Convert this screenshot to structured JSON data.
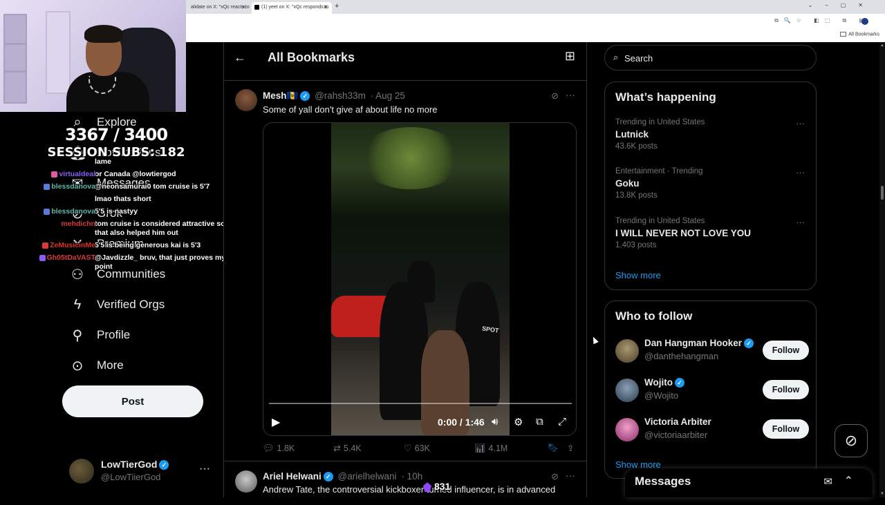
{
  "browser": {
    "tabs": [
      {
        "label": "alidate on X: \"xQc reacts to"
      },
      {
        "label": "(1) yeet on X: \"xQc responds to",
        "active": true
      }
    ],
    "bookmarks_folder": "All Bookmarks"
  },
  "stream_overlay": {
    "sub_count": "3367 / 3400",
    "session_subs": "SESSION SUBS: 182",
    "bits": "831",
    "chat": [
      {
        "user": "",
        "message": "lame",
        "color": "#ffffff"
      },
      {
        "user": "virtualdeal",
        "message": "or Canada @lowtiergod",
        "color": "#8a5cf6"
      },
      {
        "user": "blessdanova",
        "message": "@neonsamurai0 tom cruise is 5'7",
        "color": "#5fb8a8"
      },
      {
        "user": "",
        "message": "lmao thats short",
        "color": "#ffffff"
      },
      {
        "user": "blessdanova",
        "message": "5'5 is nastyy",
        "color": "#5fb8a8"
      },
      {
        "user": "mehdichn",
        "message": "tom cruise is considered attractive so that also helped him out",
        "color": "#d93a3a"
      },
      {
        "user": "ZeMusicinMe",
        "message": "5'5 is being generous kai is 5'3",
        "color": "#e0302b"
      },
      {
        "user": "Gh05tDaVAST",
        "message": "@Javdizzle_ bruv, that just proves my point",
        "color": "#d93a3a"
      }
    ]
  },
  "sidebar": {
    "items": [
      {
        "label": "Explore",
        "icon": "search-icon"
      },
      {
        "label": "Notifications",
        "icon": "bell-icon"
      },
      {
        "label": "Messages",
        "icon": "mail-icon"
      },
      {
        "label": "Grok",
        "icon": "grok-icon"
      },
      {
        "label": "Premium",
        "icon": "x-logo-icon"
      },
      {
        "label": "Communities",
        "icon": "people-icon"
      },
      {
        "label": "Verified Orgs",
        "icon": "lightning-icon"
      },
      {
        "label": "Profile",
        "icon": "person-icon"
      },
      {
        "label": "More",
        "icon": "more-circle-icon"
      }
    ],
    "post_button": "Post",
    "account": {
      "name": "LowTierGod",
      "handle": "@LowTiierGod"
    }
  },
  "main": {
    "title": "All Bookmarks",
    "tweets": [
      {
        "name": "Mesh🇧🇧",
        "handle": "@rahsh33m",
        "time": "· Aug 25",
        "text": "Some of yall don't give af about life no more",
        "video_time": "0:00 / 1:46",
        "video_shirt_text": "SPOT",
        "replies": "1.8K",
        "reposts": "5.4K",
        "likes": "63K",
        "views": "4.1M"
      },
      {
        "name": "Ariel Helwani",
        "handle": "@arielhelwani",
        "time": "· 10h",
        "text": "Andrew Tate, the controversial kickboxer turned influencer, is in advanced"
      }
    ]
  },
  "right": {
    "search_placeholder": "Search",
    "trends_title": "What’s happening",
    "trends": [
      {
        "meta": "Trending in United States",
        "name": "Lutnick",
        "count": "43.6K posts"
      },
      {
        "meta": "Entertainment · Trending",
        "name": "Goku",
        "count": "13.8K posts"
      },
      {
        "meta": "Trending in United States",
        "name": "I WILL NEVER NOT LOVE YOU",
        "count": "1,403 posts"
      }
    ],
    "show_more": "Show more",
    "who_title": "Who to follow",
    "follow": [
      {
        "name": "Dan Hangman Hooker",
        "handle": "@danthehangman",
        "button": "Follow",
        "avatar_color": "#7a6a48"
      },
      {
        "name": "Wojito",
        "handle": "@Wojito",
        "button": "Follow",
        "avatar_color": "#4a5a6a"
      },
      {
        "name": "Victoria Arbiter",
        "handle": "@victoriaarbiter",
        "button": "Follow",
        "avatar_color": "#c45a8a"
      }
    ],
    "show_more_2": "Show more",
    "messages": "Messages"
  }
}
